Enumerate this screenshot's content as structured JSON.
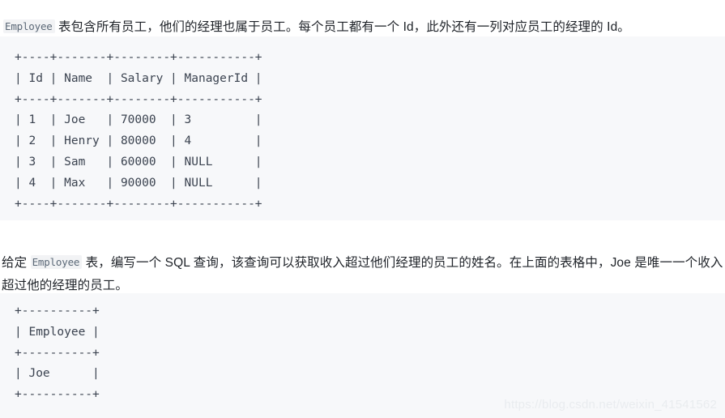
{
  "article": {
    "paragraph_1": {
      "before_code": "",
      "code": "Employee",
      "after_code": " 表包含所有员工，他们的经理也属于员工。每个员工都有一个 Id，此外还有一列对应员工的经理的 Id。"
    },
    "paragraph_2": {
      "before_code": "给定 ",
      "code": "Employee",
      "after_code": " 表，编写一个 SQL 查询，该查询可以获取收入超过他们经理的员工的姓名。在上面的表格中，Joe 是唯一一个收入超过他的经理的员工。"
    }
  },
  "code_block_1": {
    "language": "text",
    "text": "+----+-------+--------+-----------+\n| Id | Name  | Salary | ManagerId |\n+----+-------+--------+-----------+\n| 1  | Joe   | 70000  | 3         |\n| 2  | Henry | 80000  | 4         |\n| 3  | Sam   | 60000  | NULL      |\n| 4  | Max   | 90000  | NULL      |\n+----+-------+--------+-----------+",
    "table": {
      "headers": [
        "Id",
        "Name",
        "Salary",
        "ManagerId"
      ],
      "rows": [
        [
          "1",
          "Joe",
          "70000",
          "3"
        ],
        [
          "2",
          "Henry",
          "80000",
          "4"
        ],
        [
          "3",
          "Sam",
          "60000",
          "NULL"
        ],
        [
          "4",
          "Max",
          "90000",
          "NULL"
        ]
      ]
    }
  },
  "code_block_2": {
    "language": "text",
    "text": "+----------+\n| Employee |\n+----------+\n| Joe      |\n+----------+",
    "table": {
      "headers": [
        "Employee"
      ],
      "rows": [
        [
          "Joe"
        ]
      ]
    }
  },
  "watermark": {
    "text": "https://blog.csdn.net/weixin_41541562"
  },
  "colors": {
    "page_background": "#ffffff",
    "code_block_background": "#f7f8fa",
    "code_text": "#3b4350",
    "body_text": "#1f2329",
    "inline_code_text": "#5b6877",
    "inline_code_background": "#f2f3f5",
    "watermark": "#e9ecef"
  }
}
